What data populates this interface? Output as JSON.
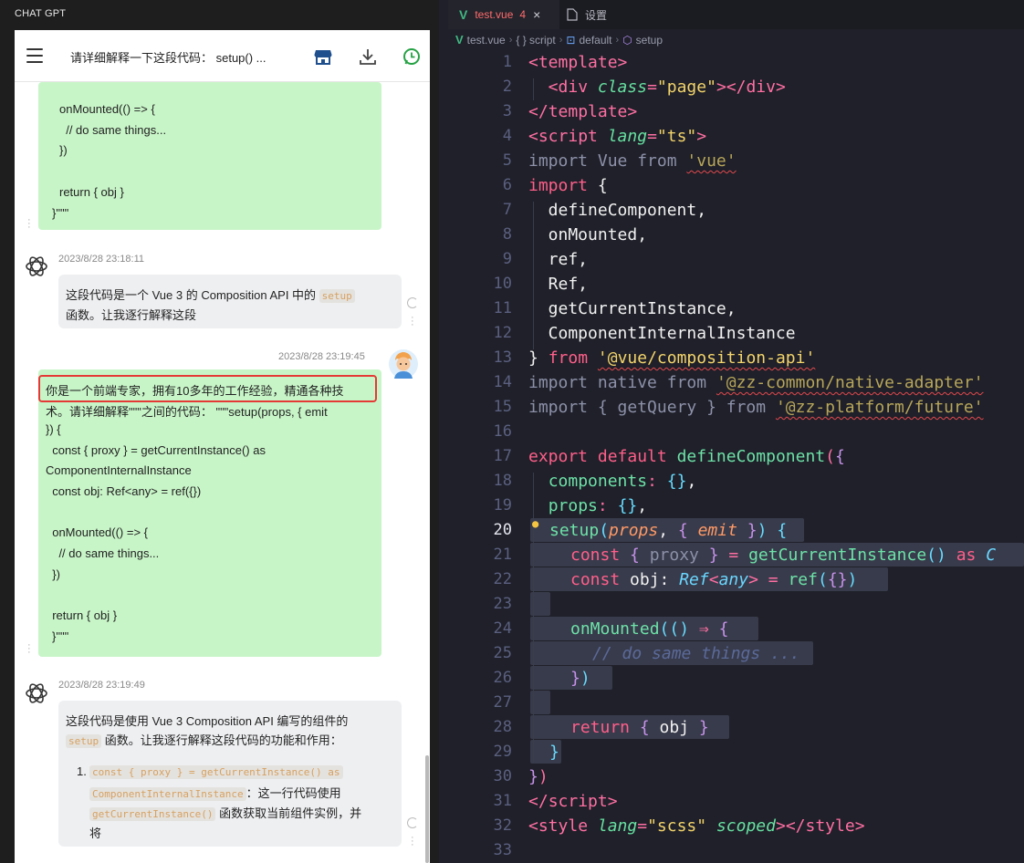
{
  "left_panel": {
    "app_title": "CHAT GPT",
    "chat_title": "请详细解释一下这段代码： setup() ...",
    "icons": {
      "menu": "hamburger-icon",
      "store": "store-icon",
      "download": "download-icon",
      "whatsapp": "whatsapp-icon"
    },
    "colors": {
      "user_bubble": "#c8f5c8",
      "assistant_bubble": "#eeeff1",
      "highlight_border": "#e53935"
    },
    "top_bubble_lines": [
      "onMounted(() => {",
      "  // do same things...",
      "})",
      "",
      "return { obj }",
      "}\"\"\""
    ],
    "msg1": {
      "timestamp": "2023/8/28 23:18:11",
      "text_line1_a": "这段代码是一个 Vue 3 的 Composition API 中的",
      "code": "setup",
      "text_line2": "函数。让我逐行解释这段"
    },
    "msg2": {
      "timestamp": "2023/8/28 23:19:45",
      "highlighted": "你是一个前端专家，拥有10多年的工作经验，精通各种技",
      "lines": [
        "术。请详细解释\"\"\"之间的代码： \"\"\"setup(props, { emit",
        "}) {",
        "  const { proxy } = getCurrentInstance() as",
        "ComponentInternalInstance",
        "  const obj: Ref<any> = ref({})",
        "",
        "  onMounted(() => {",
        "    // do same things...",
        "  })",
        "",
        "  return { obj }",
        "}\"\"\""
      ]
    },
    "msg3": {
      "timestamp": "2023/8/28 23:19:49",
      "line1": "这段代码是使用 Vue 3 Composition API 编写的组件的",
      "code1": "setup",
      "line2_rest": "函数。让我逐行解释这段代码的功能和作用：",
      "list_num": "1.",
      "code2a": "const { proxy } = getCurrentInstance() as",
      "code2b": "ComponentInternalInstance",
      "rest2b": "：这一行代码使用",
      "code3": "getCurrentInstance()",
      "rest3": "函数获取当前组件实例，并",
      "rest4": "将"
    }
  },
  "editor": {
    "tabs": [
      {
        "label": "test.vue",
        "badge": "4",
        "close": "×",
        "icon": "vue-icon"
      },
      {
        "label": "设置",
        "icon": "file-icon"
      }
    ],
    "breadcrumb": [
      "test.vue",
      "{ } script",
      "default",
      "setup"
    ],
    "active_line": 20,
    "line_numbers": [
      "1",
      "2",
      "3",
      "4",
      "5",
      "6",
      "7",
      "8",
      "9",
      "10",
      "11",
      "12",
      "13",
      "14",
      "15",
      "16",
      "17",
      "18",
      "19",
      "20",
      "21",
      "22",
      "23",
      "24",
      "25",
      "26",
      "27",
      "28",
      "29",
      "30",
      "31",
      "32",
      "33"
    ],
    "code": {
      "l1": [
        "<",
        "template",
        ">"
      ],
      "l2": [
        "  <",
        "div",
        " ",
        "class",
        "=",
        "\"page\"",
        "></",
        "div",
        ">"
      ],
      "l3": [
        "</",
        "template",
        ">"
      ],
      "l4": [
        "<",
        "script",
        " ",
        "lang",
        "=",
        "\"ts\"",
        ">"
      ],
      "l5": [
        "import",
        " Vue ",
        "from",
        " ",
        "'vue'"
      ],
      "l6": [
        "import",
        " {"
      ],
      "l7": "  defineComponent,",
      "l8": "  onMounted,",
      "l9": "  ref,",
      "l10": "  Ref,",
      "l11": "  getCurrentInstance,",
      "l12": "  ComponentInternalInstance",
      "l13": [
        "} ",
        "from",
        " ",
        "'@vue/composition-api'"
      ],
      "l14": [
        "import",
        " native ",
        "from",
        " ",
        "'@zz-common/native-adapter'"
      ],
      "l15": [
        "import",
        " { getQuery } ",
        "from",
        " ",
        "'@zz-platform/future'"
      ],
      "l17": [
        "export",
        " ",
        "default",
        " ",
        "defineComponent",
        "(",
        "{"
      ],
      "l18": [
        "  ",
        "components",
        ": ",
        "{}",
        ","
      ],
      "l19": [
        "  ",
        "props",
        ": ",
        "{}",
        ","
      ],
      "l20": [
        "setup",
        "(",
        "props",
        ", ",
        "{",
        " emit ",
        "}",
        ") ",
        "{"
      ],
      "l21": [
        "const",
        " ",
        "{",
        " proxy ",
        "}",
        " = ",
        "getCurrentInstance",
        "() ",
        "as",
        " C"
      ],
      "l22": [
        "const",
        " obj: ",
        "Ref",
        "<",
        "any",
        "> = ",
        "ref",
        "(",
        "{}",
        ")"
      ],
      "l24": [
        "onMounted",
        "(() ",
        "⇒",
        " ",
        "{"
      ],
      "l25": "// do same things ...",
      "l26": [
        "}",
        ")"
      ],
      "l28": [
        "return",
        " ",
        "{",
        " obj ",
        "}"
      ],
      "l29": "}",
      "l30": [
        "}",
        ")"
      ],
      "l31": [
        "</",
        "script",
        ">"
      ],
      "l32": [
        "<",
        "style",
        " ",
        "lang",
        "=",
        "\"scss\"",
        " ",
        "scoped",
        "></",
        "style",
        ">"
      ]
    }
  }
}
